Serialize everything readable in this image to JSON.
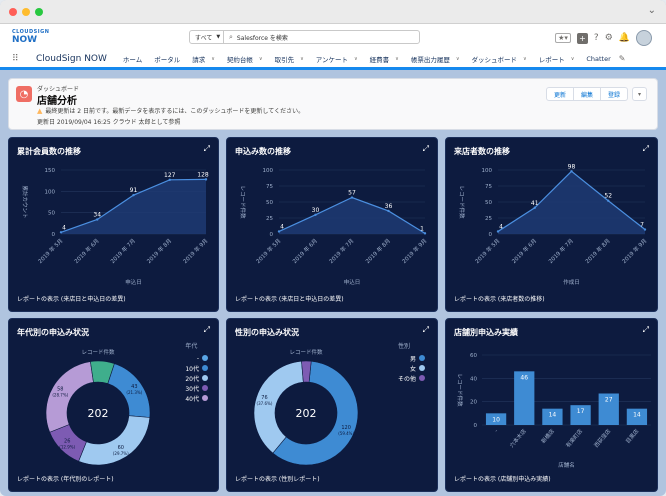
{
  "window": {
    "dots": [
      "#ff5f57",
      "#febc2e",
      "#28c840"
    ]
  },
  "header": {
    "logo_top": "CLOUDSIGN",
    "logo_bottom": "NOW",
    "search_scope": "すべて",
    "search_placeholder": "Salesforce を検索"
  },
  "nav": {
    "app_name": "CloudSign NOW",
    "items": [
      {
        "label": "ホーム",
        "menu": false
      },
      {
        "label": "ポータル",
        "menu": false
      },
      {
        "label": "請求",
        "menu": true
      },
      {
        "label": "契約台帳",
        "menu": true,
        "active": true
      },
      {
        "label": "取引先",
        "menu": true
      },
      {
        "label": "アンケート",
        "menu": true
      },
      {
        "label": "経費書",
        "menu": true
      },
      {
        "label": "帳票出力履歴",
        "menu": true
      },
      {
        "label": "ダッシュボード",
        "menu": true
      },
      {
        "label": "レポート",
        "menu": true
      },
      {
        "label": "Chatter",
        "menu": false
      }
    ]
  },
  "dashboard": {
    "label": "ダッシュボード",
    "title": "店舗分析",
    "warning": "最終更新は 2 日前です。最新データを表示するには、このダッシュボードを更新してください。",
    "updated": "更新日 2019/09/04 16:25 クラウド 太郎として参照",
    "buttons": {
      "refresh": "更新",
      "edit": "編集",
      "subscribe": "登録"
    }
  },
  "panels": [
    {
      "title": "累計会員数の推移",
      "footer": "レポートの表示 (来店日と申込日の差異)"
    },
    {
      "title": "申込み数の推移",
      "footer": "レポートの表示 (来店日と申込日の差異)"
    },
    {
      "title": "来店者数の推移",
      "footer": "レポートの表示 (来店者数の推移)"
    },
    {
      "title": "年代別の申込み状況",
      "footer": "レポートの表示 (年代別のレポート)"
    },
    {
      "title": "性別の申込み状況",
      "footer": "レポートの表示 (性別レポート)"
    },
    {
      "title": "店舗別申込み実績",
      "footer": "レポートの表示 (店舗別申込み実績)"
    }
  ],
  "chart_data": [
    {
      "type": "area",
      "title": "累計会員数の推移",
      "xlabel": "申込日",
      "ylabel": "累計カウント",
      "categories": [
        "2019 年 5月",
        "2019 年 6月",
        "2019 年 7月",
        "2019 年 8月",
        "2019 年 9月"
      ],
      "values": [
        4,
        34,
        91,
        127,
        128
      ],
      "ylim": [
        0,
        150
      ],
      "yticks": [
        0,
        50,
        100,
        150
      ],
      "color": "#3b6fb6"
    },
    {
      "type": "area",
      "title": "申込み数の推移",
      "xlabel": "申込日",
      "ylabel": "レコード件数",
      "categories": [
        "2019 年 5月",
        "2019 年 6月",
        "2019 年 7月",
        "2019 年 8月",
        "2019 年 9月"
      ],
      "values": [
        4,
        30,
        57,
        36,
        1
      ],
      "ylim": [
        0,
        100
      ],
      "yticks": [
        0,
        25,
        50,
        75,
        100
      ],
      "color": "#3b6fb6"
    },
    {
      "type": "area",
      "title": "来店者数の推移",
      "xlabel": "作成日",
      "ylabel": "レコード件数",
      "categories": [
        "2019 年 5月",
        "2019 年 6月",
        "2019 年 7月",
        "2019 年 8月",
        "2019 年 9月"
      ],
      "values": [
        4,
        41,
        98,
        52,
        7
      ],
      "ylim": [
        0,
        100
      ],
      "yticks": [
        0,
        25,
        50,
        75,
        100
      ],
      "color": "#3b6fb6"
    },
    {
      "type": "pie",
      "title": "年代別の申込み状況",
      "center_label": "レコード件数",
      "total": "202",
      "legend_title": "年代",
      "slices": [
        {
          "name": "-",
          "value": 0,
          "label": "",
          "color": "#5aa6e6"
        },
        {
          "name": "10代",
          "value": 43,
          "label": "43\n(21.3%)",
          "color": "#3e8bd3"
        },
        {
          "name": "20代",
          "value": 60,
          "label": "60\n(29.7%)",
          "color": "#9fc9f0"
        },
        {
          "name": "30代",
          "value": 26,
          "label": "26\n(12.9%)",
          "color": "#7d5bb3"
        },
        {
          "name": "40代",
          "value": 58,
          "label": "58\n(28.7%)",
          "color": "#b69bd6"
        },
        {
          "name": "",
          "value": 15,
          "label": "",
          "color": "#3fae8c"
        }
      ]
    },
    {
      "type": "pie",
      "title": "性別の申込み状況",
      "center_label": "レコード件数",
      "total": "202",
      "legend_title": "性別",
      "slices": [
        {
          "name": "男",
          "value": 120,
          "label": "120\n(59.4%)",
          "color": "#3e8bd3"
        },
        {
          "name": "女",
          "value": 76,
          "label": "76\n(37.6%)",
          "color": "#9fc9f0"
        },
        {
          "name": "その他",
          "value": 6,
          "label": "",
          "color": "#7d5bb3"
        }
      ]
    },
    {
      "type": "bar",
      "title": "店舗別申込み実績",
      "xlabel": "店舗名",
      "ylabel": "レコード件数",
      "categories": [
        "-",
        "六本木店",
        "新橋店",
        "有楽町店",
        "西荻窪店",
        "目黒店"
      ],
      "values": [
        10,
        46,
        14,
        17,
        27,
        14
      ],
      "ylim": [
        0,
        60
      ],
      "yticks": [
        0,
        20,
        40,
        60
      ],
      "color": "#3e8bd3"
    }
  ]
}
